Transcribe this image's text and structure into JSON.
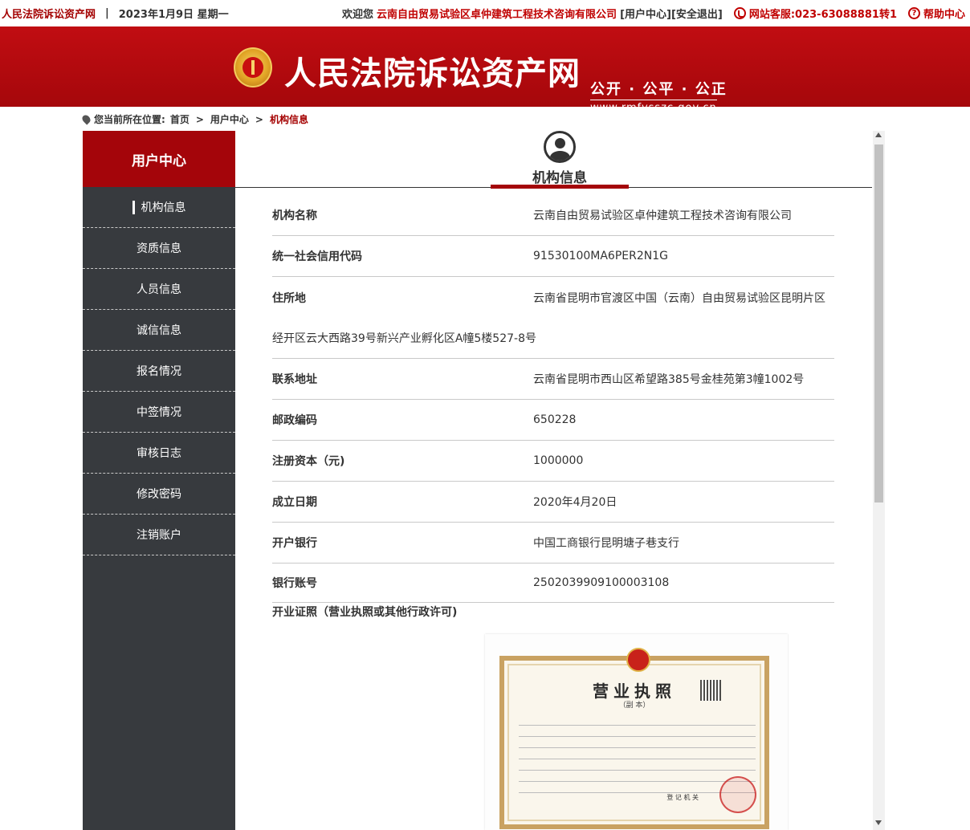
{
  "topbar": {
    "site_name": "人民法院诉讼资产网",
    "separator": "|",
    "date": "2023年1月9日 星期一",
    "welcome": "欢迎您",
    "company": "云南自由贸易试验区卓仲建筑工程技术咨询有限公司",
    "user_center_link": "[用户中心]",
    "logout_link": "[安全退出]",
    "hotline": "网站客服:023-63088881转1",
    "help": "帮助中心",
    "phone_icon": "phone-icon",
    "help_icon": "question-icon"
  },
  "banner": {
    "title": "人民法院诉讼资产网",
    "slogan": "公开 · 公平 · 公正",
    "url": "www.rmfysszc.gov.cn"
  },
  "breadcrumb": {
    "prefix": "您当前所在位置:",
    "items": [
      "首页",
      "用户中心",
      "机构信息"
    ],
    "separator": ">"
  },
  "sidebar": {
    "title": "用户中心",
    "items": [
      {
        "label": "机构信息",
        "active": true
      },
      {
        "label": "资质信息"
      },
      {
        "label": "人员信息"
      },
      {
        "label": "诚信信息"
      },
      {
        "label": "报名情况"
      },
      {
        "label": "中签情况"
      },
      {
        "label": "审核日志"
      },
      {
        "label": "修改密码"
      },
      {
        "label": "注销账户"
      }
    ]
  },
  "main": {
    "title": "机构信息",
    "fields": [
      {
        "label": "机构名称",
        "value": "云南自由贸易试验区卓仲建筑工程技术咨询有限公司"
      },
      {
        "label": "统一社会信用代码",
        "value": "91530100MA6PER2N1G"
      },
      {
        "label": "住所地",
        "value": "云南省昆明市官渡区中国（云南）自由贸易试验区昆明片区"
      },
      {
        "label": "",
        "value": "经开区云大西路39号新兴产业孵化区A幢5楼527-8号"
      },
      {
        "label": "联系地址",
        "value": "云南省昆明市西山区希望路385号金桂苑第3幢1002号"
      },
      {
        "label": "邮政编码",
        "value": "650228"
      },
      {
        "label": "注册资本（元)",
        "value": "1000000"
      },
      {
        "label": "成立日期",
        "value": "2020年4月20日"
      },
      {
        "label": "开户银行",
        "value": "中国工商银行昆明塘子巷支行"
      },
      {
        "label": "银行账号",
        "value": "2502039909100003108"
      }
    ],
    "license_label": "开业证照（营业执照或其他行政许可)",
    "certificate": {
      "title": "营业执照",
      "subtitle": "（副 本）",
      "registration": "登 记 机 关"
    }
  },
  "colors": {
    "brand_red": "#a4050a",
    "sidebar_bg": "#373a3e",
    "banner_red": "#c10d12"
  }
}
